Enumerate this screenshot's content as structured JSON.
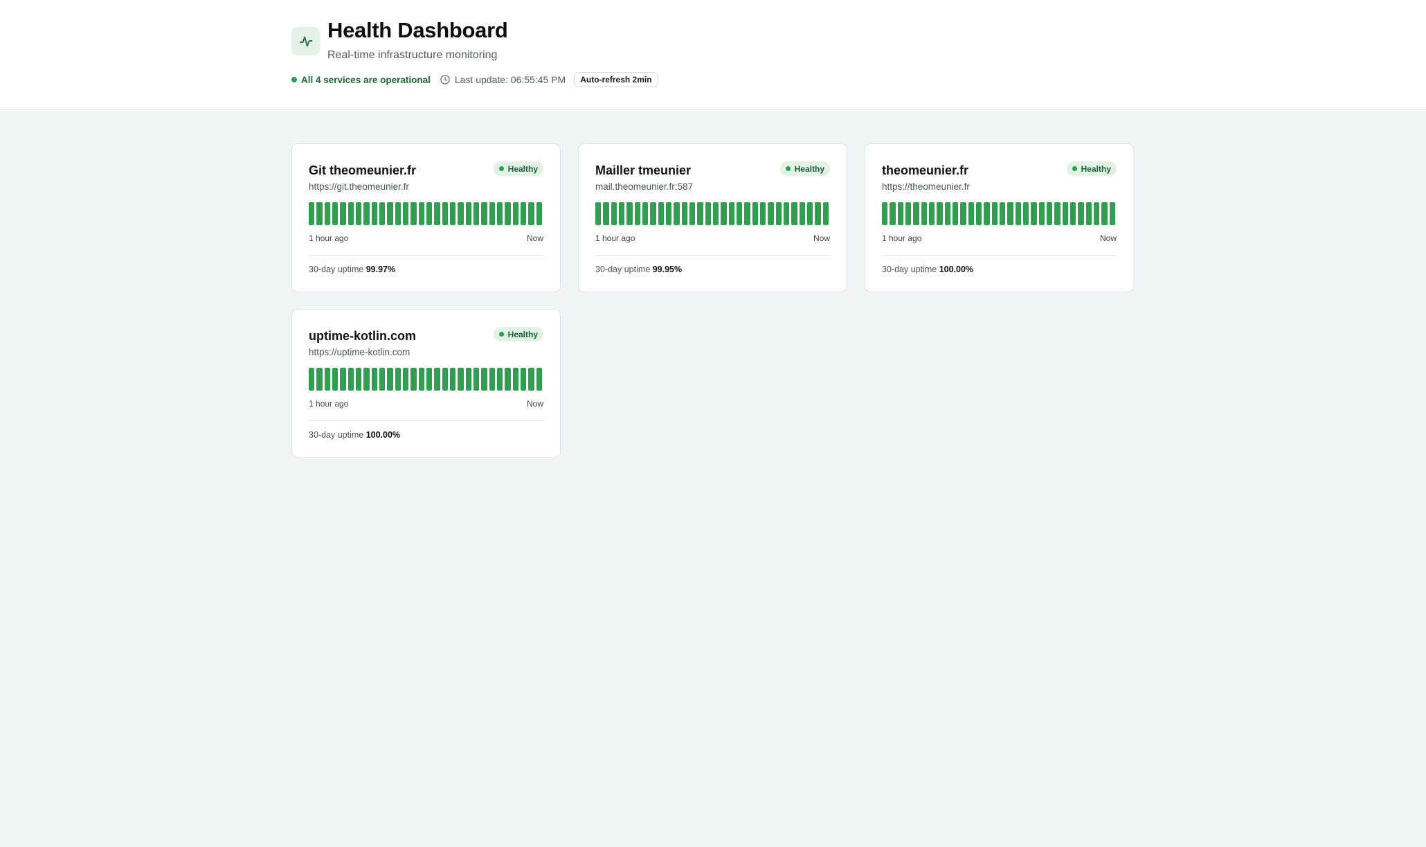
{
  "header": {
    "logo_icon": "activity-pulse-icon",
    "title": "Health Dashboard",
    "subtitle": "Real-time infrastructure monitoring",
    "status_text": "All 4 services are operational",
    "status_color": "#22a44a",
    "clock_icon": "clock-icon",
    "last_update": "Last update: 06:55:45 PM",
    "auto_refresh": "Auto-refresh 2min"
  },
  "services": [
    {
      "name": "Git theomeunier.fr",
      "url": "https://git.theomeunier.fr",
      "status": "Healthy",
      "range_start": "1 hour ago",
      "range_end": "Now",
      "uptime_label": "30-day uptime",
      "uptime_value": "99.97%",
      "checks": [
        "up",
        "up",
        "up",
        "up",
        "up",
        "up",
        "up",
        "up",
        "up",
        "up",
        "up",
        "up",
        "up",
        "up",
        "up",
        "up",
        "up",
        "up",
        "up",
        "up",
        "up",
        "up",
        "up",
        "up",
        "up",
        "up",
        "up",
        "up",
        "up",
        "up"
      ]
    },
    {
      "name": "Mailler tmeunier",
      "url": "mail.theomeunier.fr:587",
      "status": "Healthy",
      "range_start": "1 hour ago",
      "range_end": "Now",
      "uptime_label": "30-day uptime",
      "uptime_value": "99.95%",
      "checks": [
        "up",
        "up",
        "up",
        "up",
        "up",
        "up",
        "up",
        "up",
        "up",
        "up",
        "up",
        "up",
        "up",
        "up",
        "up",
        "up",
        "up",
        "up",
        "up",
        "up",
        "up",
        "up",
        "up",
        "up",
        "up",
        "up",
        "up",
        "up",
        "up",
        "up"
      ]
    },
    {
      "name": "theomeunier.fr",
      "url": "https://theomeunier.fr",
      "status": "Healthy",
      "range_start": "1 hour ago",
      "range_end": "Now",
      "uptime_label": "30-day uptime",
      "uptime_value": "100.00%",
      "checks": [
        "up",
        "up",
        "up",
        "up",
        "up",
        "up",
        "up",
        "up",
        "up",
        "up",
        "up",
        "up",
        "up",
        "up",
        "up",
        "up",
        "up",
        "up",
        "up",
        "up",
        "up",
        "up",
        "up",
        "up",
        "up",
        "up",
        "up",
        "up",
        "up",
        "up"
      ]
    },
    {
      "name": "uptime-kotlin.com",
      "url": "https://uptime-kotlin.com",
      "status": "Healthy",
      "range_start": "1 hour ago",
      "range_end": "Now",
      "uptime_label": "30-day uptime",
      "uptime_value": "100.00%",
      "checks": [
        "up",
        "up",
        "up",
        "up",
        "up",
        "up",
        "up",
        "up",
        "up",
        "up",
        "up",
        "up",
        "up",
        "up",
        "up",
        "up",
        "up",
        "up",
        "up",
        "up",
        "up",
        "up",
        "up",
        "up",
        "up",
        "up",
        "up",
        "up",
        "up",
        "up"
      ]
    }
  ],
  "colors": {
    "healthy": "#2e9e4f",
    "badge_bg": "#e1f1e5",
    "page_bg": "#f1f4f4"
  }
}
